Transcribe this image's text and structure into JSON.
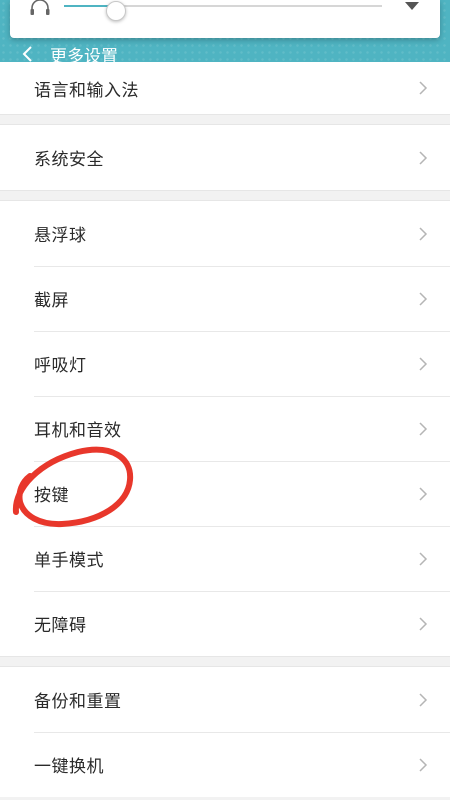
{
  "header": {
    "title": "更多设置",
    "bg_color": "#4fb4c2"
  },
  "volume": {
    "level": 0.16,
    "icon": "headphone-icon",
    "expand_icon": "chevron-down-icon"
  },
  "groups": [
    {
      "items": [
        {
          "label": "语言和输入法"
        }
      ]
    },
    {
      "items": [
        {
          "label": "系统安全"
        }
      ]
    },
    {
      "items": [
        {
          "label": "悬浮球"
        },
        {
          "label": "截屏"
        },
        {
          "label": "呼吸灯"
        },
        {
          "label": "耳机和音效"
        },
        {
          "label": "按键"
        },
        {
          "label": "单手模式"
        },
        {
          "label": "无障碍"
        }
      ]
    },
    {
      "items": [
        {
          "label": "备份和重置"
        },
        {
          "label": "一键换机"
        }
      ]
    }
  ],
  "annotation_color": "#e8372b"
}
